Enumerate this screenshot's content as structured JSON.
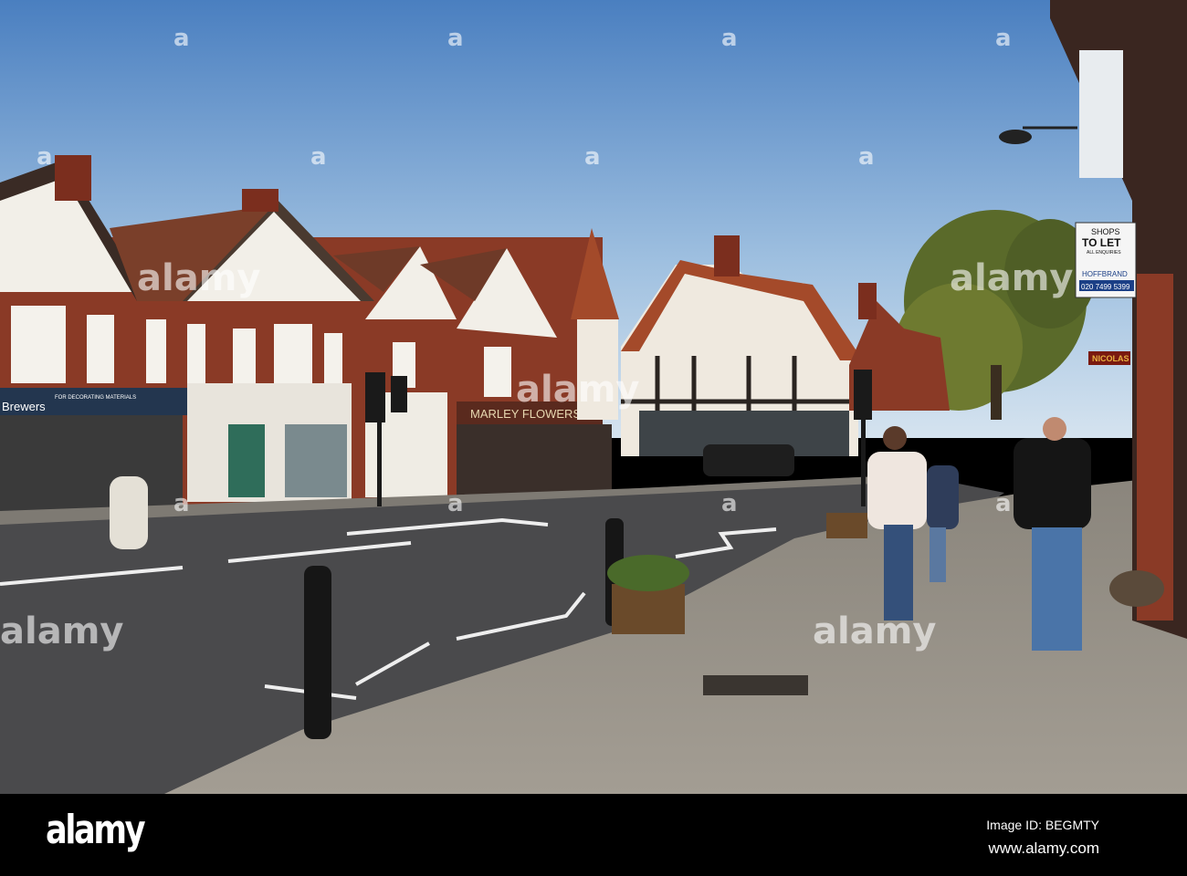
{
  "watermark": {
    "word": "alamy",
    "mark": "a"
  },
  "signs": {
    "shops_to_let_top": "SHOPS",
    "shops_to_let": "TO LET",
    "all_enquiries": "ALL ENQUIRIES",
    "agent": "HOFFBRAND",
    "phone": "020 7499 5399",
    "nicolas": "NICOLAS",
    "flowers": "MARLEY FLOWERS",
    "brewers": "Brewers",
    "decorating": "FOR DECORATING MATERIALS"
  },
  "footer": {
    "logo": "alamy",
    "image_id": "Image ID: BEGMTY",
    "url": "www.alamy.com"
  },
  "colors": {
    "sky_top": "#4a7fc0",
    "sky_bottom": "#cfe0ef",
    "brick": "#8a3a26",
    "road": "#4a4a4c",
    "pavement": "#9a948a"
  }
}
